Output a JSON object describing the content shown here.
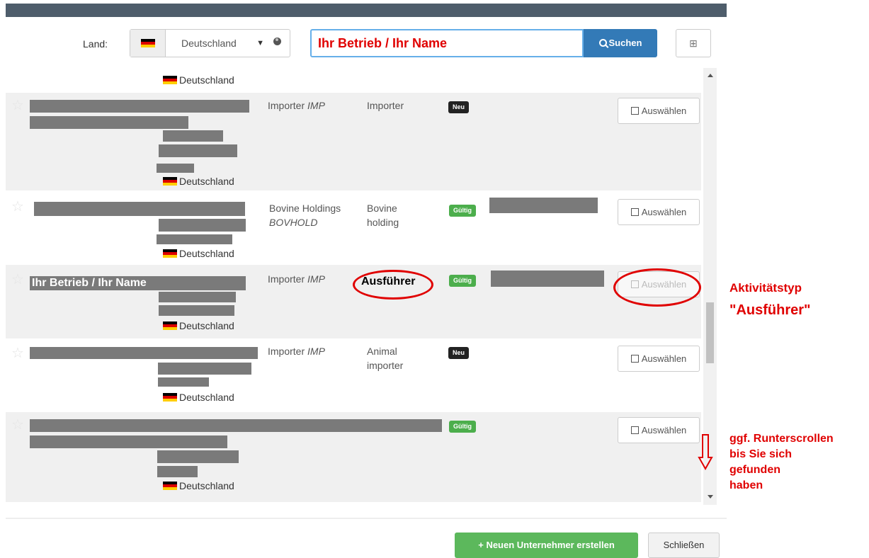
{
  "search": {
    "country_label": "Land:",
    "country_value": "Deutschland",
    "query_value": "Ihr Betrieb / Ihr Name",
    "search_button": "Suchen",
    "expand_icon": "⊞"
  },
  "results": {
    "top_country": "Deutschland",
    "rows": [
      {
        "country": "Deutschland",
        "type": "Importer",
        "type_code": "IMP",
        "activity": "Importer",
        "status": "Neu",
        "action": "Auswählen"
      },
      {
        "country": "Deutschland",
        "type": "Bovine Holdings",
        "type_code": "BOVHOLD",
        "activity_1": "Bovine",
        "activity_2": "holding",
        "status": "Gültig",
        "action": "Auswählen"
      },
      {
        "country": "Deutschland",
        "name": "Ihr Betrieb / Ihr Name",
        "type": "Importer",
        "type_code": "IMP",
        "activity": "Ausführer",
        "status": "Gültig",
        "action": "Auswählen"
      },
      {
        "country": "Deutschland",
        "type": "Importer",
        "type_code": "IMP",
        "activity_1": "Animal",
        "activity_2": "importer",
        "status": "Neu",
        "action": "Auswählen"
      },
      {
        "country": "Deutschland",
        "status": "Gültig",
        "action": "Auswählen"
      }
    ]
  },
  "footer": {
    "new_button": "Neuen Unternehmer erstellen",
    "new_icon": "+",
    "close_button": "Schließen"
  },
  "annotations": {
    "activity_line1": "Aktivitätstyp",
    "activity_line2": "\"Ausführer\"",
    "scroll_line1": "ggf. Runterscrollen",
    "scroll_line2": "bis Sie sich",
    "scroll_line3": "gefunden",
    "scroll_line4": "haben"
  },
  "colors": {
    "accent": "#337ab7",
    "success": "#5cb85c",
    "annotation": "#e00000"
  }
}
